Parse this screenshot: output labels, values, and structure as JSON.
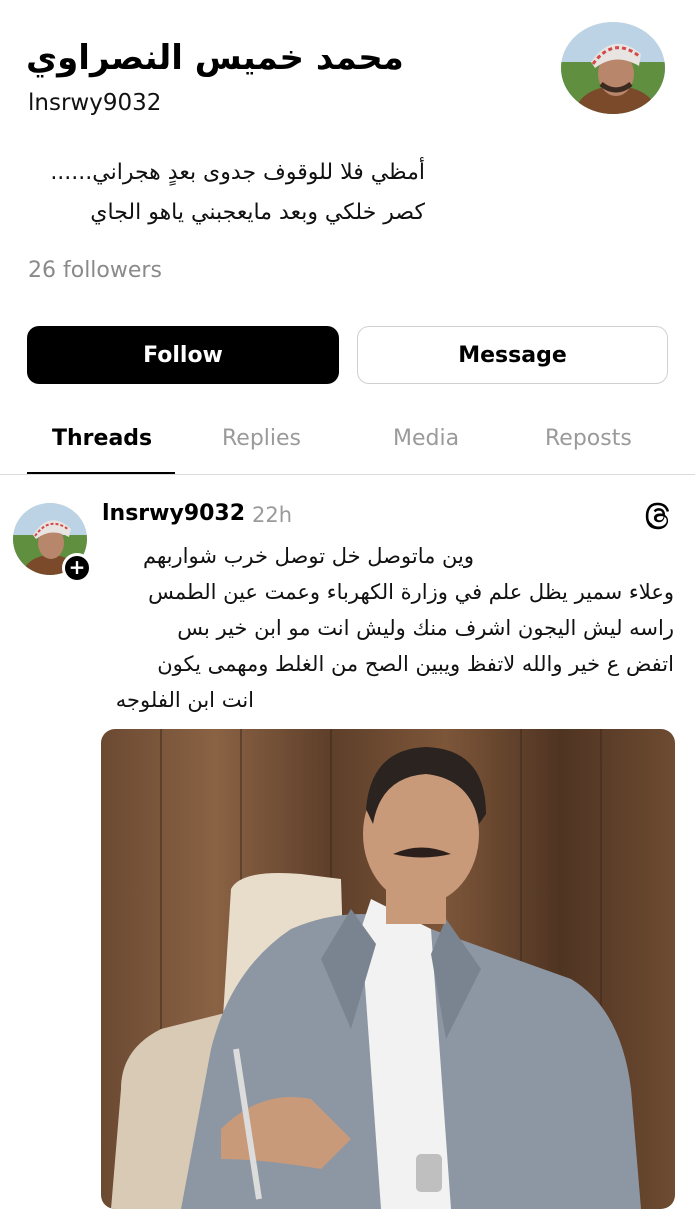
{
  "profile": {
    "name": "محمد خميس النصراوي",
    "handle": "lnsrwy9032",
    "bio_lines": [
      "أمظي فلا للوقوف جدوى بعدٍ هجراني......",
      "كصر خلكي وبعد مايعجبني ياهو الجاي"
    ],
    "followers": "26 followers"
  },
  "actions": {
    "follow_label": "Follow",
    "message_label": "Message"
  },
  "tabs": [
    {
      "label": "Threads",
      "active": true
    },
    {
      "label": "Replies",
      "active": false
    },
    {
      "label": "Media",
      "active": false
    },
    {
      "label": "Reposts",
      "active": false
    }
  ],
  "post": {
    "author": "lnsrwy9032",
    "time": "22h",
    "text_lines": [
      "وين ماتوصل خل توصل خرب شواربهم",
      "وعلاء سمير  يظل  علم في وزارة الكهرباء وعمت عين الطمس",
      "راسه ليش اليجون اشرف منك وليش انت مو ابن خير  بس",
      "اتفض ع خير والله لاتفظ ويبين الصح من الغلط ومهمى يكون",
      "انت ابن الفلوجه"
    ],
    "icon": "threads-logo-icon"
  },
  "colors": {
    "primary": "#000000",
    "muted": "#9a9a9a",
    "border": "#dcdcdc"
  }
}
